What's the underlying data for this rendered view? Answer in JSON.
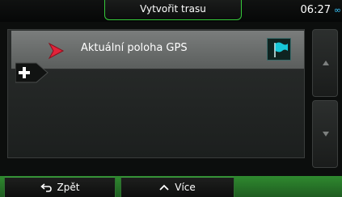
{
  "header": {
    "title": "Vytvořit trasu",
    "clock": "06:27",
    "clock_suffix": "∞"
  },
  "route_list": {
    "items": [
      {
        "label": "Aktuální poloha GPS",
        "icon": "gps-arrow-icon",
        "action_icon": "flag-icon"
      }
    ],
    "add_icon": "plus-icon",
    "scroll_up_icon": "chevron-up-icon",
    "scroll_down_icon": "chevron-down-icon"
  },
  "footer": {
    "back_label": "Zpět",
    "back_icon": "back-arrow-icon",
    "more_label": "Více",
    "more_icon": "chevron-up-icon"
  },
  "colors": {
    "accent_green": "#35c83a",
    "arrow_red": "#e2233a",
    "flag_cyan": "#18c8d8",
    "clock_infinity": "#39c8ff"
  }
}
